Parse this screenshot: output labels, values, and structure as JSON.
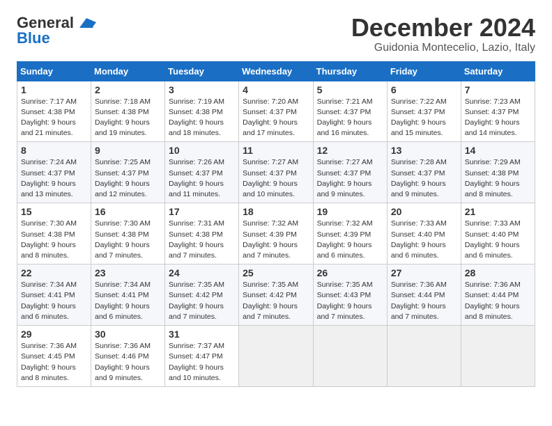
{
  "header": {
    "logo_general": "General",
    "logo_blue": "Blue",
    "month_title": "December 2024",
    "location": "Guidonia Montecelio, Lazio, Italy"
  },
  "days_of_week": [
    "Sunday",
    "Monday",
    "Tuesday",
    "Wednesday",
    "Thursday",
    "Friday",
    "Saturday"
  ],
  "weeks": [
    [
      {
        "day": 1,
        "sunrise": "7:17 AM",
        "sunset": "4:38 PM",
        "daylight": "9 hours and 21 minutes."
      },
      {
        "day": 2,
        "sunrise": "7:18 AM",
        "sunset": "4:38 PM",
        "daylight": "9 hours and 19 minutes."
      },
      {
        "day": 3,
        "sunrise": "7:19 AM",
        "sunset": "4:38 PM",
        "daylight": "9 hours and 18 minutes."
      },
      {
        "day": 4,
        "sunrise": "7:20 AM",
        "sunset": "4:37 PM",
        "daylight": "9 hours and 17 minutes."
      },
      {
        "day": 5,
        "sunrise": "7:21 AM",
        "sunset": "4:37 PM",
        "daylight": "9 hours and 16 minutes."
      },
      {
        "day": 6,
        "sunrise": "7:22 AM",
        "sunset": "4:37 PM",
        "daylight": "9 hours and 15 minutes."
      },
      {
        "day": 7,
        "sunrise": "7:23 AM",
        "sunset": "4:37 PM",
        "daylight": "9 hours and 14 minutes."
      }
    ],
    [
      {
        "day": 8,
        "sunrise": "7:24 AM",
        "sunset": "4:37 PM",
        "daylight": "9 hours and 13 minutes."
      },
      {
        "day": 9,
        "sunrise": "7:25 AM",
        "sunset": "4:37 PM",
        "daylight": "9 hours and 12 minutes."
      },
      {
        "day": 10,
        "sunrise": "7:26 AM",
        "sunset": "4:37 PM",
        "daylight": "9 hours and 11 minutes."
      },
      {
        "day": 11,
        "sunrise": "7:27 AM",
        "sunset": "4:37 PM",
        "daylight": "9 hours and 10 minutes."
      },
      {
        "day": 12,
        "sunrise": "7:27 AM",
        "sunset": "4:37 PM",
        "daylight": "9 hours and 9 minutes."
      },
      {
        "day": 13,
        "sunrise": "7:28 AM",
        "sunset": "4:37 PM",
        "daylight": "9 hours and 9 minutes."
      },
      {
        "day": 14,
        "sunrise": "7:29 AM",
        "sunset": "4:38 PM",
        "daylight": "9 hours and 8 minutes."
      }
    ],
    [
      {
        "day": 15,
        "sunrise": "7:30 AM",
        "sunset": "4:38 PM",
        "daylight": "9 hours and 8 minutes."
      },
      {
        "day": 16,
        "sunrise": "7:30 AM",
        "sunset": "4:38 PM",
        "daylight": "9 hours and 7 minutes."
      },
      {
        "day": 17,
        "sunrise": "7:31 AM",
        "sunset": "4:38 PM",
        "daylight": "9 hours and 7 minutes."
      },
      {
        "day": 18,
        "sunrise": "7:32 AM",
        "sunset": "4:39 PM",
        "daylight": "9 hours and 7 minutes."
      },
      {
        "day": 19,
        "sunrise": "7:32 AM",
        "sunset": "4:39 PM",
        "daylight": "9 hours and 6 minutes."
      },
      {
        "day": 20,
        "sunrise": "7:33 AM",
        "sunset": "4:40 PM",
        "daylight": "9 hours and 6 minutes."
      },
      {
        "day": 21,
        "sunrise": "7:33 AM",
        "sunset": "4:40 PM",
        "daylight": "9 hours and 6 minutes."
      }
    ],
    [
      {
        "day": 22,
        "sunrise": "7:34 AM",
        "sunset": "4:41 PM",
        "daylight": "9 hours and 6 minutes."
      },
      {
        "day": 23,
        "sunrise": "7:34 AM",
        "sunset": "4:41 PM",
        "daylight": "9 hours and 6 minutes."
      },
      {
        "day": 24,
        "sunrise": "7:35 AM",
        "sunset": "4:42 PM",
        "daylight": "9 hours and 7 minutes."
      },
      {
        "day": 25,
        "sunrise": "7:35 AM",
        "sunset": "4:42 PM",
        "daylight": "9 hours and 7 minutes."
      },
      {
        "day": 26,
        "sunrise": "7:35 AM",
        "sunset": "4:43 PM",
        "daylight": "9 hours and 7 minutes."
      },
      {
        "day": 27,
        "sunrise": "7:36 AM",
        "sunset": "4:44 PM",
        "daylight": "9 hours and 7 minutes."
      },
      {
        "day": 28,
        "sunrise": "7:36 AM",
        "sunset": "4:44 PM",
        "daylight": "9 hours and 8 minutes."
      }
    ],
    [
      {
        "day": 29,
        "sunrise": "7:36 AM",
        "sunset": "4:45 PM",
        "daylight": "9 hours and 8 minutes."
      },
      {
        "day": 30,
        "sunrise": "7:36 AM",
        "sunset": "4:46 PM",
        "daylight": "9 hours and 9 minutes."
      },
      {
        "day": 31,
        "sunrise": "7:37 AM",
        "sunset": "4:47 PM",
        "daylight": "9 hours and 10 minutes."
      },
      null,
      null,
      null,
      null
    ]
  ]
}
